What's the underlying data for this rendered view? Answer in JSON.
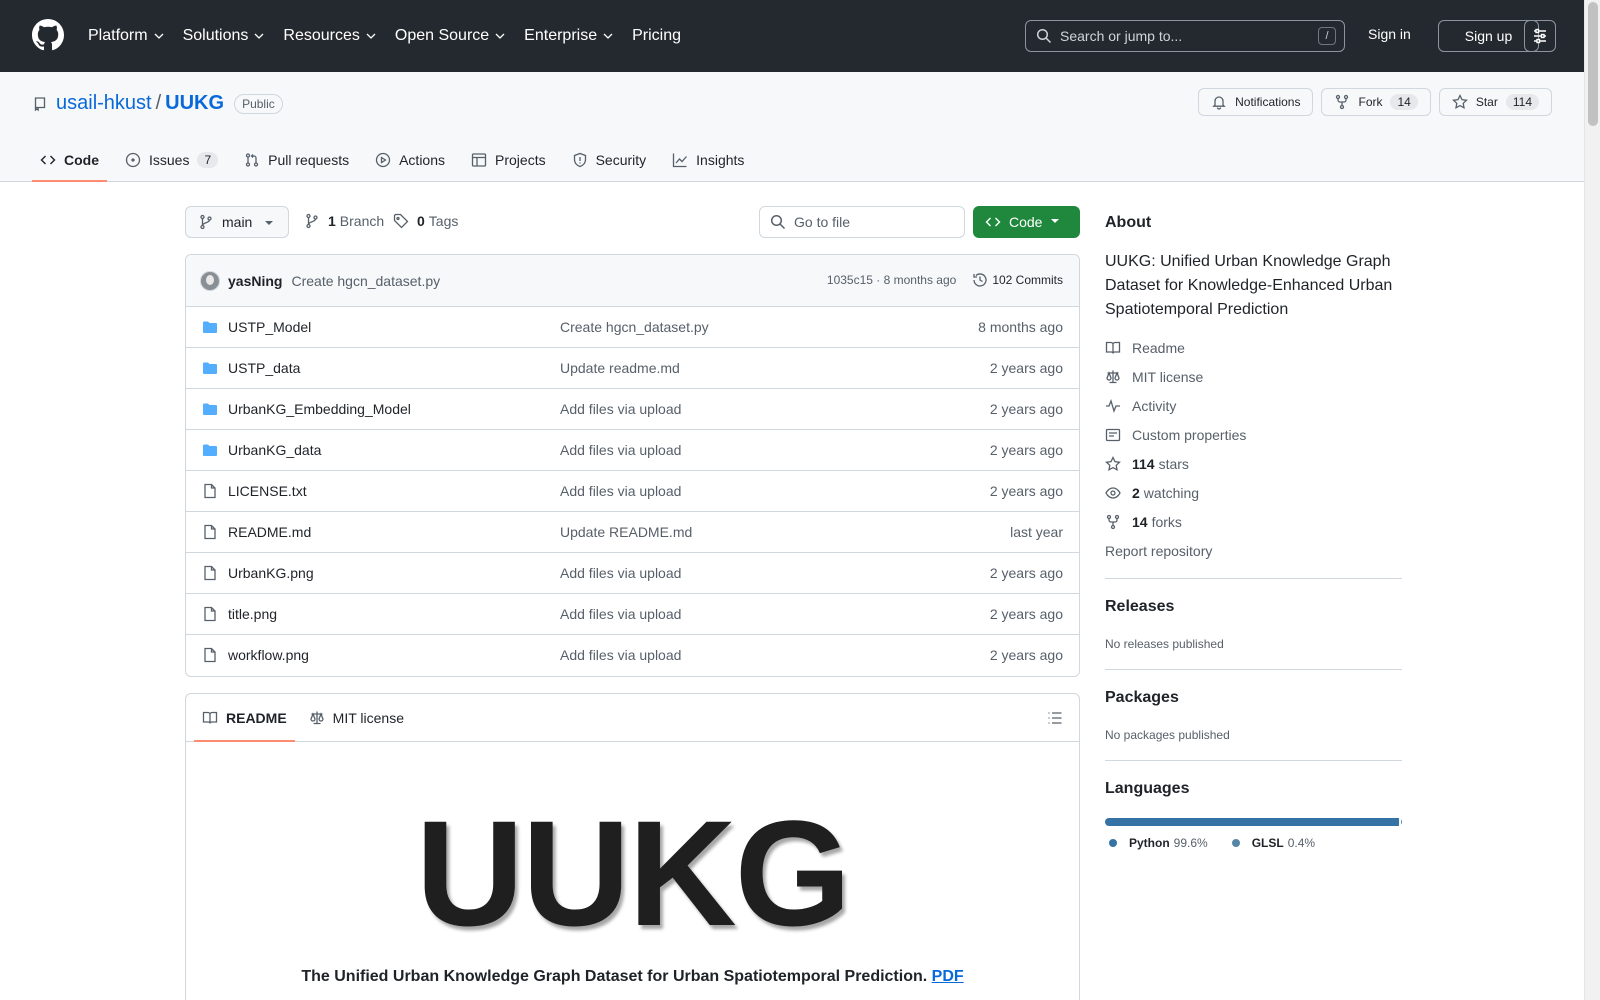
{
  "header": {
    "nav": [
      "Platform",
      "Solutions",
      "Resources",
      "Open Source",
      "Enterprise",
      "Pricing"
    ],
    "search_placeholder": "Search or jump to...",
    "search_kbd": "/",
    "sign_in": "Sign in",
    "sign_up": "Sign up"
  },
  "repo": {
    "owner": "usail-hkust",
    "slash": "/",
    "name": "UUKG",
    "visibility": "Public",
    "notifications": "Notifications",
    "fork_label": "Fork",
    "fork_count": "14",
    "star_label": "Star",
    "star_count": "114"
  },
  "tabs": {
    "code": "Code",
    "issues": "Issues",
    "issues_count": "7",
    "pulls": "Pull requests",
    "actions": "Actions",
    "projects": "Projects",
    "security": "Security",
    "insights": "Insights"
  },
  "branch": {
    "name": "main",
    "branches_count": "1",
    "branches_label": "Branch",
    "tags_count": "0",
    "tags_label": "Tags",
    "goto_placeholder": "Go to file",
    "code_button": "Code"
  },
  "latest_commit": {
    "author": "yasNing",
    "message": "Create hgcn_dataset.py",
    "hash_time": "1035c15 · 8 months ago",
    "commits_label": "102 Commits"
  },
  "files": [
    {
      "name": "USTP_Model",
      "type": "dir",
      "message": "Create hgcn_dataset.py",
      "date": "8 months ago"
    },
    {
      "name": "USTP_data",
      "type": "dir",
      "message": "Update readme.md",
      "date": "2 years ago"
    },
    {
      "name": "UrbanKG_Embedding_Model",
      "type": "dir",
      "message": "Add files via upload",
      "date": "2 years ago"
    },
    {
      "name": "UrbanKG_data",
      "type": "dir",
      "message": "Add files via upload",
      "date": "2 years ago"
    },
    {
      "name": "LICENSE.txt",
      "type": "file",
      "message": "Add files via upload",
      "date": "2 years ago"
    },
    {
      "name": "README.md",
      "type": "file",
      "message": "Update README.md",
      "date": "last year"
    },
    {
      "name": "UrbanKG.png",
      "type": "file",
      "message": "Add files via upload",
      "date": "2 years ago"
    },
    {
      "name": "title.png",
      "type": "file",
      "message": "Add files via upload",
      "date": "2 years ago"
    },
    {
      "name": "workflow.png",
      "type": "file",
      "message": "Add files via upload",
      "date": "2 years ago"
    }
  ],
  "readme": {
    "tab_readme": "README",
    "tab_license": "MIT license",
    "logo_text": "UUKG",
    "subtitle": "The Unified Urban Knowledge Graph Dataset for Urban Spatiotemporal Prediction.",
    "pdf_link": "PDF"
  },
  "about": {
    "heading": "About",
    "description": "UUKG: Unified Urban Knowledge Graph Dataset for Knowledge-Enhanced Urban Spatiotemporal Prediction",
    "readme": "Readme",
    "license": "MIT license",
    "activity": "Activity",
    "custom_properties": "Custom properties",
    "stars_count": "114",
    "stars_label": "stars",
    "watching_count": "2",
    "watching_label": "watching",
    "forks_count": "14",
    "forks_label": "forks",
    "report": "Report repository"
  },
  "releases": {
    "heading": "Releases",
    "empty": "No releases published"
  },
  "packages": {
    "heading": "Packages",
    "empty": "No packages published"
  },
  "languages": {
    "heading": "Languages",
    "items": [
      {
        "name": "Python",
        "percent": "99.6%",
        "value": 99.6,
        "color": "#3572A5"
      },
      {
        "name": "GLSL",
        "percent": "0.4%",
        "value": 0.4,
        "color": "#5686a5"
      }
    ]
  },
  "colors": {
    "accent": "#0969da",
    "header_bg": "#24292f",
    "code_button": "#1f883d",
    "tab_underline": "#fd8c73"
  }
}
